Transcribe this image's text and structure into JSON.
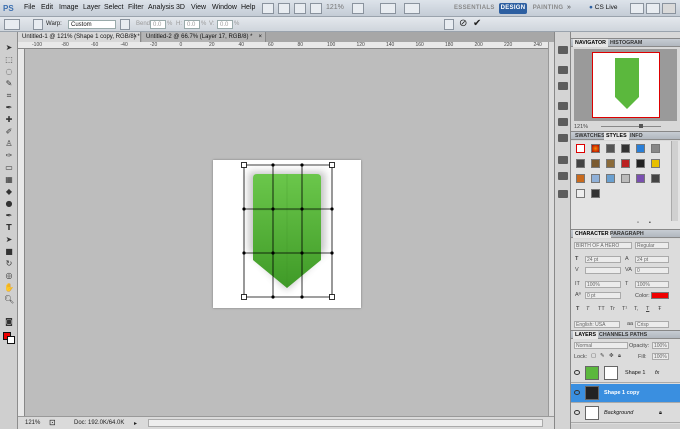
{
  "app": {
    "logo": "PS"
  },
  "menu": [
    "File",
    "Edit",
    "Image",
    "Layer",
    "Select",
    "Filter",
    "Analysis",
    "3D",
    "View",
    "Window",
    "Help"
  ],
  "top_right": {
    "zoom": "121%",
    "essentials": "ESSENTIALS",
    "design": "DESIGN",
    "painting": "PAINTING",
    "cs_live": "CS Live"
  },
  "options": {
    "warp_label": "Warp:",
    "warp_value": "Custom",
    "bend_label": "Bend:",
    "bend_value": "0.0",
    "h_label": "H:",
    "h_value": "0.0",
    "v_label": "V:",
    "v_value": "0.0"
  },
  "tabs": [
    {
      "label": "Untitled-1 @ 121% (Shape 1 copy, RGB/8) *"
    },
    {
      "label": "Untitled-2 @ 66.7% (Layer 17, RGB/8) *"
    }
  ],
  "ruler": [
    "-100",
    "-80",
    "-60",
    "-40",
    "-20",
    "0",
    "20",
    "40",
    "60",
    "80",
    "100",
    "120",
    "140",
    "160",
    "180",
    "200",
    "220",
    "240"
  ],
  "status": {
    "zoom": "121%",
    "doc": "Doc: 192.0K/64.0K"
  },
  "navigator": {
    "tabs": [
      "NAVIGATOR",
      "HISTOGRAM"
    ],
    "zoom": "121%"
  },
  "styles_panel": {
    "tabs": [
      "SWATCHES",
      "STYLES",
      "INFO"
    ]
  },
  "character": {
    "tabs": [
      "CHARACTER",
      "PARAGRAPH"
    ],
    "font": "BIRTH OF A HERO",
    "style": "Regular",
    "size": "24 pt",
    "leading": "24 pt",
    "tracking": "0",
    "scale_v": "100%",
    "scale_h": "100%",
    "baseline": "0 pt",
    "color_label": "Color:",
    "language": "English: USA",
    "aa_label": "aa",
    "aa_value": "Crisp",
    "styles_row": [
      "T",
      "T",
      "TT",
      "Tr",
      "T¹",
      "T,",
      "T",
      "Ŧ"
    ]
  },
  "layers": {
    "tabs": [
      "LAYERS",
      "CHANNELS",
      "PATHS"
    ],
    "blend": "Normal",
    "opacity_label": "Opacity:",
    "opacity": "100%",
    "lock_label": "Lock:",
    "fill_label": "Fill:",
    "fill": "100%",
    "items": [
      {
        "name": "Shape 1"
      },
      {
        "name": "Shape 1 copy"
      },
      {
        "name": "Background"
      }
    ]
  },
  "colors": {
    "accent": "#2d5fa1",
    "foreground": "#e00000",
    "shape_green": "#57b53a",
    "selected_layer": "#3a8fe0"
  }
}
